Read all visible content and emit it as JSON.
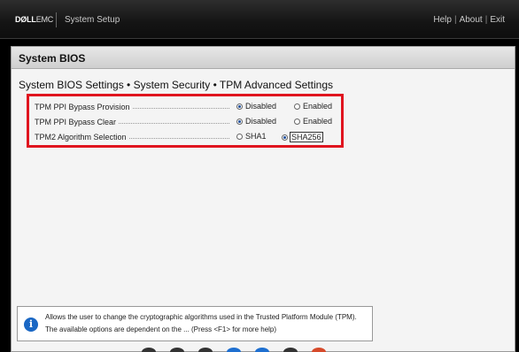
{
  "header": {
    "brand_main": "DØLL",
    "brand_sub": "EMC",
    "app_title": "System Setup",
    "links": [
      "Help",
      "About",
      "Exit"
    ]
  },
  "panel": {
    "title": "System BIOS",
    "breadcrumb": "System BIOS Settings • System Security • TPM Advanced Settings"
  },
  "settings": [
    {
      "label": "TPM PPI Bypass Provision",
      "options": [
        {
          "text": "Disabled",
          "selected": true
        },
        {
          "text": "Enabled",
          "selected": false
        }
      ]
    },
    {
      "label": "TPM PPI Bypass Clear",
      "options": [
        {
          "text": "Disabled",
          "selected": true
        },
        {
          "text": "Enabled",
          "selected": false
        }
      ]
    },
    {
      "label": "TPM2 Algorithm Selection",
      "options": [
        {
          "text": "SHA1",
          "selected": false
        },
        {
          "text": "SHA256",
          "selected": true
        }
      ]
    }
  ],
  "help": {
    "icon": "info-icon",
    "text": "Allows the user to change the cryptographic algorithms used in the Trusted Platform Module (TPM). The available options are dependent on the ... (Press <F1> for more help)"
  },
  "colors": {
    "highlight": "#e0141e",
    "radio_selected": "#1e4f9c",
    "info_icon": "#1a67c4"
  }
}
